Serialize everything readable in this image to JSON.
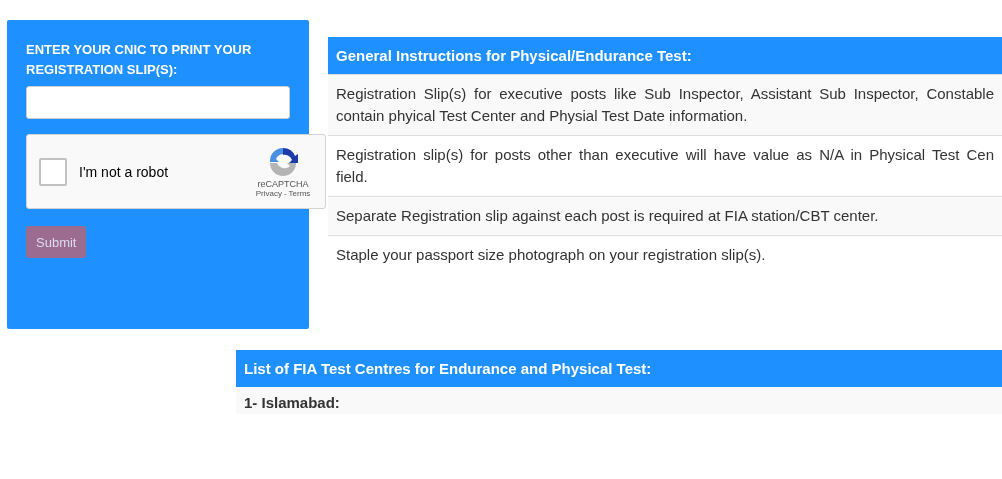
{
  "cnic_panel": {
    "heading": "ENTER YOUR CNIC TO PRINT YOUR REGISTRATION SLIP(S):",
    "captcha": {
      "label": "I'm not a robot",
      "checked": false,
      "brand": "reCAPTCHA",
      "privacy": "Privacy",
      "separator": "-",
      "terms": "Terms"
    },
    "submit": "Submit"
  },
  "instructions": {
    "title": "General Instructions for Physical/Endurance Test:",
    "items": [
      {
        "lines": [
          "Registration Slip(s) for executive posts like Sub Inspector, Assistant Sub Inspector, Constable",
          "contain phyical Test Center and Physial Test Date information."
        ]
      },
      {
        "lines": [
          "Registration slip(s) for posts other than executive will have value as N/A in Physical Test Cen",
          "field."
        ]
      },
      {
        "lines": [
          "Separate Registration slip against each post is required at FIA station/CBT center."
        ]
      },
      {
        "lines": [
          "Staple your passport size photograph on your registration slip(s)."
        ]
      }
    ]
  },
  "test_centres": {
    "title": "List of FIA Test Centres for Endurance and Physical Test:",
    "items": [
      "1- Islamabad:"
    ]
  }
}
